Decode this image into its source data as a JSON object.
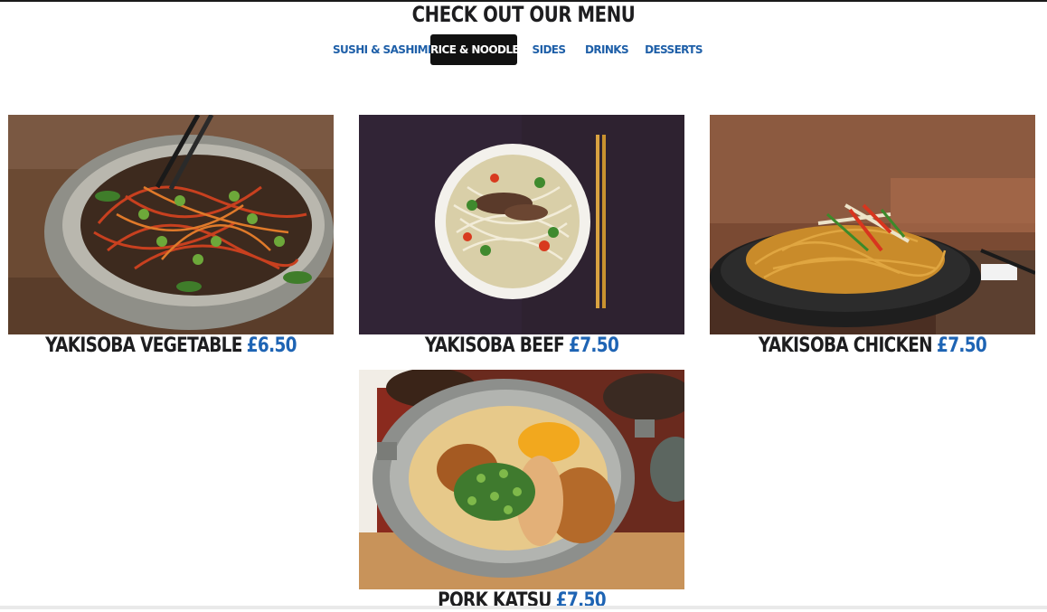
{
  "menu": {
    "title": "CHECK OUT OUR MENU",
    "tabs": [
      {
        "label": "SUSHI & SASHIMI",
        "active": false
      },
      {
        "label": "RICE & NOODLES",
        "active": true
      },
      {
        "label": "SIDES",
        "active": false
      },
      {
        "label": "DRINKS",
        "active": false
      },
      {
        "label": "DESSERTS",
        "active": false
      }
    ],
    "items": [
      {
        "name": "YAKISOBA VEGETABLE",
        "price": "£6.50"
      },
      {
        "name": "YAKISOBA BEEF",
        "price": "£7.50"
      },
      {
        "name": "YAKISOBA CHICKEN",
        "price": "£7.50"
      },
      {
        "name": "PORK KATSU",
        "price": "£7.50"
      }
    ]
  },
  "colors": {
    "accent_blue": "#1e64b4",
    "active_tab_bg": "#111111",
    "heading_text": "#1d1d1f"
  }
}
